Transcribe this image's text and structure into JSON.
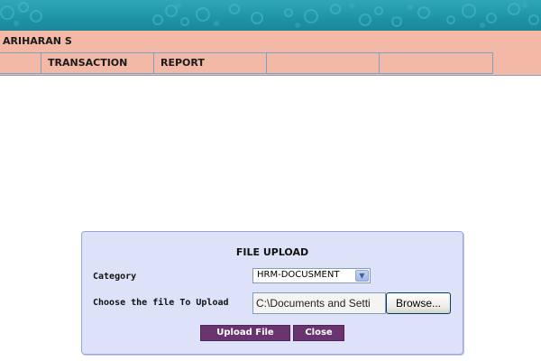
{
  "header": {
    "user_name": "ARIHARAN S"
  },
  "menu": {
    "items": [
      {
        "label": ""
      },
      {
        "label": "TRANSACTION"
      },
      {
        "label": "REPORT"
      },
      {
        "label": ""
      },
      {
        "label": ""
      }
    ]
  },
  "upload": {
    "title": "FILE UPLOAD",
    "category_label": "Category",
    "category_value": "HRM-DOCUSMENT",
    "file_label": "Choose the file To Upload",
    "file_value": "C:\\Documents and Setti",
    "browse_label": "Browse...",
    "upload_label": "Upload File",
    "close_label": "Close"
  },
  "colors": {
    "banner": "#1f93a6",
    "menu_bg": "#f4b9a6",
    "panel_bg": "#dde2f8",
    "button_bg": "#6a3470"
  }
}
